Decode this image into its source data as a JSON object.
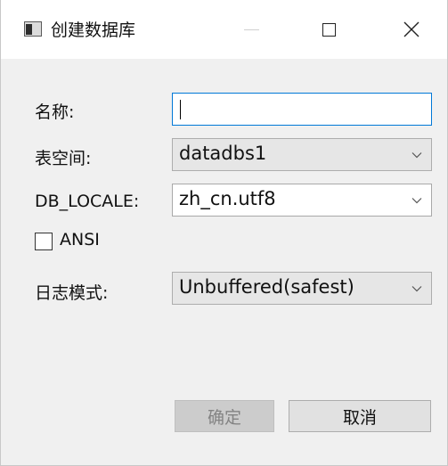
{
  "window": {
    "title": "创建数据库"
  },
  "form": {
    "name_label": "名称:",
    "name_value": "",
    "tablespace_label": "表空间:",
    "tablespace_value": "datadbs1",
    "locale_label": "DB_LOCALE:",
    "locale_value": "zh_cn.utf8",
    "ansi_label": "ANSI",
    "ansi_checked": false,
    "logmode_label": "日志模式:",
    "logmode_value": "Unbuffered(safest)"
  },
  "buttons": {
    "ok_label": "确定",
    "cancel_label": "取消"
  },
  "icons": {
    "app": "window-app-icon",
    "minimize": "minimize-icon",
    "maximize": "maximize-icon",
    "close": "close-icon",
    "dropdown": "chevron-down-icon"
  },
  "colors": {
    "focus_border": "#0078d7",
    "dialog_background": "#f0f0f0"
  }
}
